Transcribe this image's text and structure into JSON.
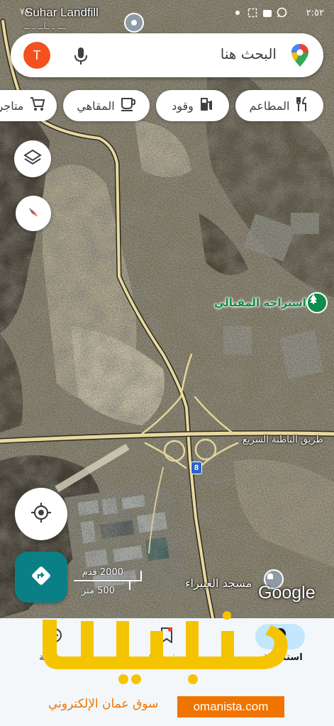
{
  "status_bar": {
    "time": "٢:٥٢",
    "left_text": "٧٨",
    "icons": [
      "whatsapp-icon",
      "wallet-icon",
      "screenshot-icon",
      "dot-icon"
    ]
  },
  "map": {
    "labels": {
      "landfill": "Suhar Landfill",
      "top_area": "ـــ ـ ـاــ ـ ــ",
      "rest_stop": "استراحة المقبالي",
      "highway": "طريق الباطنة السريع",
      "route_shield": "8",
      "mosque": "مسجد الغبيراء"
    },
    "scale": {
      "feet": "2000 قدم",
      "meters": "500 متر"
    },
    "attribution": "Google"
  },
  "search": {
    "avatar_letter": "T",
    "placeholder": "البحث هنا",
    "icons": {
      "mic": "mic-icon",
      "pin": "maps-pin-icon"
    }
  },
  "chips": [
    {
      "label": "المطاعم",
      "icon": "restaurant-icon"
    },
    {
      "label": "وقود",
      "icon": "fuel-icon"
    },
    {
      "label": "المقاهي",
      "icon": "coffee-icon"
    },
    {
      "label": "متاجر",
      "icon": "cart-icon"
    }
  ],
  "buttons": {
    "layers": "layers-icon",
    "compass": "compass-icon",
    "location": "my-location-icon",
    "directions": "directions-icon"
  },
  "bottom_nav": [
    {
      "label": "استكشاف",
      "icon": "explore-icon",
      "active": true
    },
    {
      "label": "محفوظاتك",
      "icon": "saved-icon",
      "active": false
    },
    {
      "label": "مساهمة",
      "icon": "contribute-icon",
      "active": false
    }
  ],
  "watermark": {
    "arabic": "عمانيستا",
    "subtitle": "سوق عمان الإلكتروني",
    "url": "omanista.com",
    "color": "#f5c400"
  },
  "colors": {
    "accent": "#0b7f86",
    "avatar": "#f4511e",
    "rest_label": "#0f8b4a",
    "road": "#e8d9a0"
  }
}
